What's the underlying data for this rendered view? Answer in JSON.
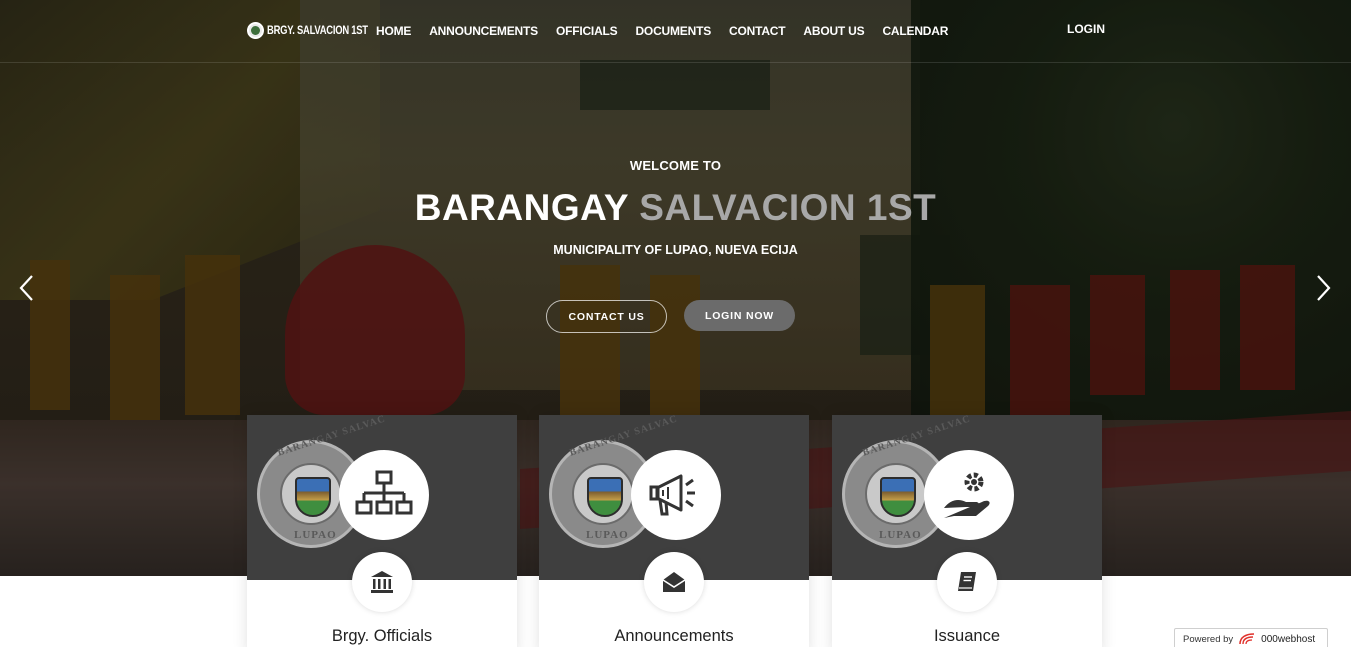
{
  "nav": {
    "brand": "BRGY. SALVACION 1ST",
    "items": [
      "HOME",
      "ANNOUNCEMENTS",
      "OFFICIALS",
      "DOCUMENTS",
      "CONTACT",
      "ABOUT US",
      "CALENDAR"
    ],
    "login": "LOGIN"
  },
  "hero": {
    "welcome": "WELCOME TO",
    "title_main": "BARANGAY",
    "title_accent": "SALVACION 1ST",
    "municipality": "MUNICIPALITY OF LUPAO, NUEVA ECIJA",
    "contact_button": "CONTACT US",
    "login_button": "LOGIN NOW"
  },
  "seal": {
    "top_text": "BARANGAY SALVAC",
    "bottom_text": "LUPAO"
  },
  "cards": [
    {
      "title": "Brgy. Officials",
      "big_icon": "org-chart-icon",
      "small_icon": "bank-icon"
    },
    {
      "title": "Announcements",
      "big_icon": "megaphone-icon",
      "small_icon": "envelope-open-icon"
    },
    {
      "title": "Issuance",
      "big_icon": "hand-gear-icon",
      "small_icon": "book-icon"
    }
  ],
  "footer": {
    "powered_by": "Powered by",
    "host": "000webhost"
  },
  "colors": {
    "accent_gray": "#a8a8a8",
    "card_top": "#3f3f3f",
    "login_button_bg": "#6b6b6b"
  }
}
